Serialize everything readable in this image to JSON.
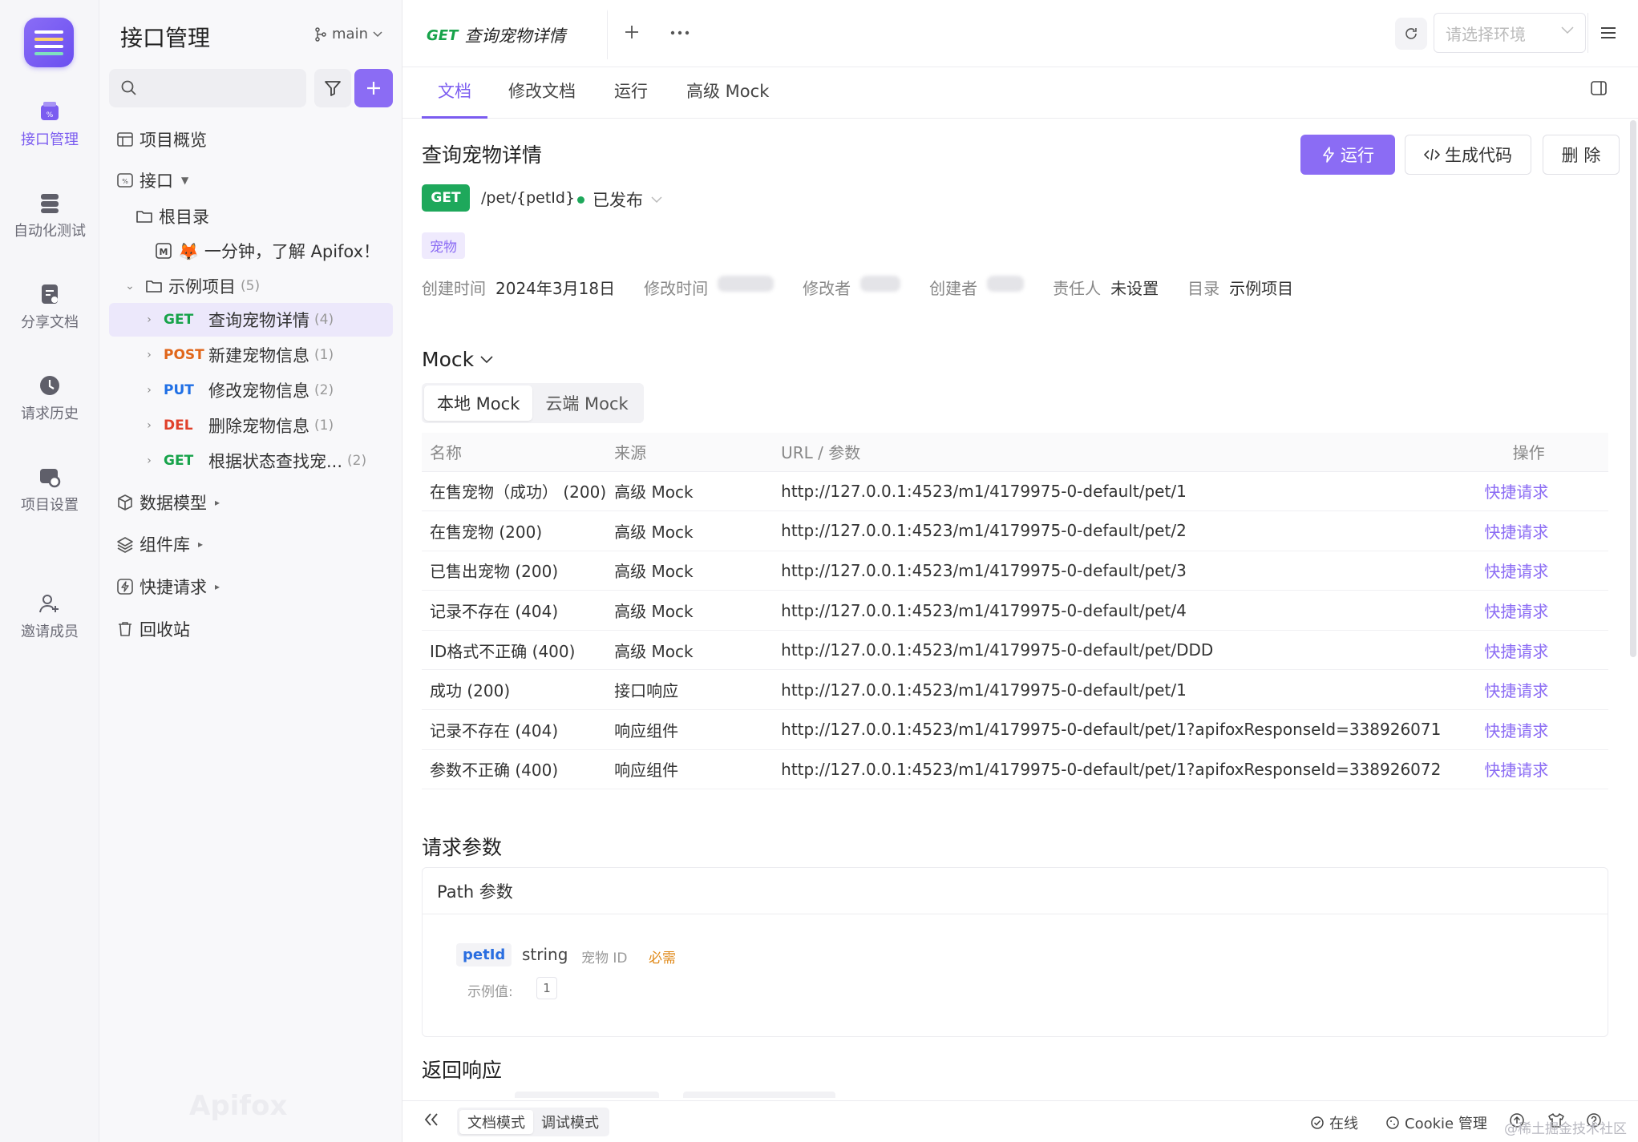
{
  "colors": {
    "accent": "#8b6cf4",
    "get": "#17a34a",
    "post": "#e0661a",
    "put": "#1f6fe5",
    "del": "#e0402a"
  },
  "rail": {
    "items": [
      {
        "label": "接口管理",
        "icon": "api-icon"
      },
      {
        "label": "自动化测试",
        "icon": "automation-icon"
      },
      {
        "label": "分享文档",
        "icon": "share-doc-icon"
      },
      {
        "label": "请求历史",
        "icon": "history-icon"
      },
      {
        "label": "项目设置",
        "icon": "settings-icon"
      },
      {
        "label": "邀请成员",
        "icon": "invite-icon"
      }
    ]
  },
  "sidebar": {
    "title": "接口管理",
    "branch": "main",
    "tree": {
      "overview": "项目概览",
      "apis": "接口",
      "root": "根目录",
      "intro": "🦊 一分钟，了解 Apifox！",
      "example_folder": "示例项目",
      "example_count": "(5)",
      "endpoints": [
        {
          "method": "GET",
          "name": "查询宠物详情",
          "count": "(4)"
        },
        {
          "method": "POST",
          "name": "新建宠物信息",
          "count": "(1)"
        },
        {
          "method": "PUT",
          "name": "修改宠物信息",
          "count": "(2)"
        },
        {
          "method": "DEL",
          "name": "删除宠物信息",
          "count": "(1)"
        },
        {
          "method": "GET",
          "name": "根据状态查找宠...",
          "count": "(2)"
        }
      ],
      "models": "数据模型",
      "components": "组件库",
      "quick_requests": "快捷请求",
      "trash": "回收站"
    },
    "watermark": "Apifox"
  },
  "tabbar": {
    "open_tab_method": "GET",
    "open_tab_title": "查询宠物详情",
    "env_placeholder": "请选择环境"
  },
  "subtabs": [
    "文档",
    "修改文档",
    "运行",
    "高级 Mock"
  ],
  "api": {
    "title": "查询宠物详情",
    "run_label": "运行",
    "gen_code_label": "生成代码",
    "delete_label": "删 除",
    "method": "GET",
    "path": "/pet/{petId}",
    "status": "已发布",
    "tag": "宠物",
    "meta": {
      "created_label": "创建时间",
      "created_value": "2024年3月18日",
      "modified_label": "修改时间",
      "modifier_label": "修改者",
      "creator_label": "创建者",
      "owner_label": "责任人",
      "owner_value": "未设置",
      "dir_label": "目录",
      "dir_value": "示例项目"
    }
  },
  "mock": {
    "title": "Mock",
    "segments": [
      "本地 Mock",
      "云端 Mock"
    ],
    "columns": [
      "名称",
      "来源",
      "URL / 参数",
      "操作"
    ],
    "rows": [
      {
        "name": "在售宠物（成功） (200)",
        "source": "高级 Mock",
        "url": "http://127.0.0.1:4523/m1/4179975-0-default/pet/1",
        "action": "快捷请求"
      },
      {
        "name": "在售宠物 (200)",
        "source": "高级 Mock",
        "url": "http://127.0.0.1:4523/m1/4179975-0-default/pet/2",
        "action": "快捷请求"
      },
      {
        "name": "已售出宠物 (200)",
        "source": "高级 Mock",
        "url": "http://127.0.0.1:4523/m1/4179975-0-default/pet/3",
        "action": "快捷请求"
      },
      {
        "name": "记录不存在 (404)",
        "source": "高级 Mock",
        "url": "http://127.0.0.1:4523/m1/4179975-0-default/pet/4",
        "action": "快捷请求"
      },
      {
        "name": "ID格式不正确 (400)",
        "source": "高级 Mock",
        "url": "http://127.0.0.1:4523/m1/4179975-0-default/pet/DDD",
        "action": "快捷请求"
      },
      {
        "name": "成功 (200)",
        "source": "接口响应",
        "url": "http://127.0.0.1:4523/m1/4179975-0-default/pet/1",
        "action": "快捷请求"
      },
      {
        "name": "记录不存在 (404)",
        "source": "响应组件",
        "url": "http://127.0.0.1:4523/m1/4179975-0-default/pet/1?apifoxResponseId=338926071",
        "action": "快捷请求"
      },
      {
        "name": "参数不正确 (400)",
        "source": "响应组件",
        "url": "http://127.0.0.1:4523/m1/4179975-0-default/pet/1?apifoxResponseId=338926072",
        "action": "快捷请求"
      }
    ]
  },
  "params": {
    "title": "请求参数",
    "path_header": "Path 参数",
    "name": "petId",
    "type": "string",
    "desc": "宠物 ID",
    "required": "必需",
    "example_label": "示例值:",
    "example_value": "1"
  },
  "response": {
    "title": "返回响应"
  },
  "bottombar": {
    "modes": [
      "文档模式",
      "调试模式"
    ],
    "online": "在线",
    "cookie": "Cookie 管理",
    "watermark": "@稀土掘金技术社区"
  }
}
